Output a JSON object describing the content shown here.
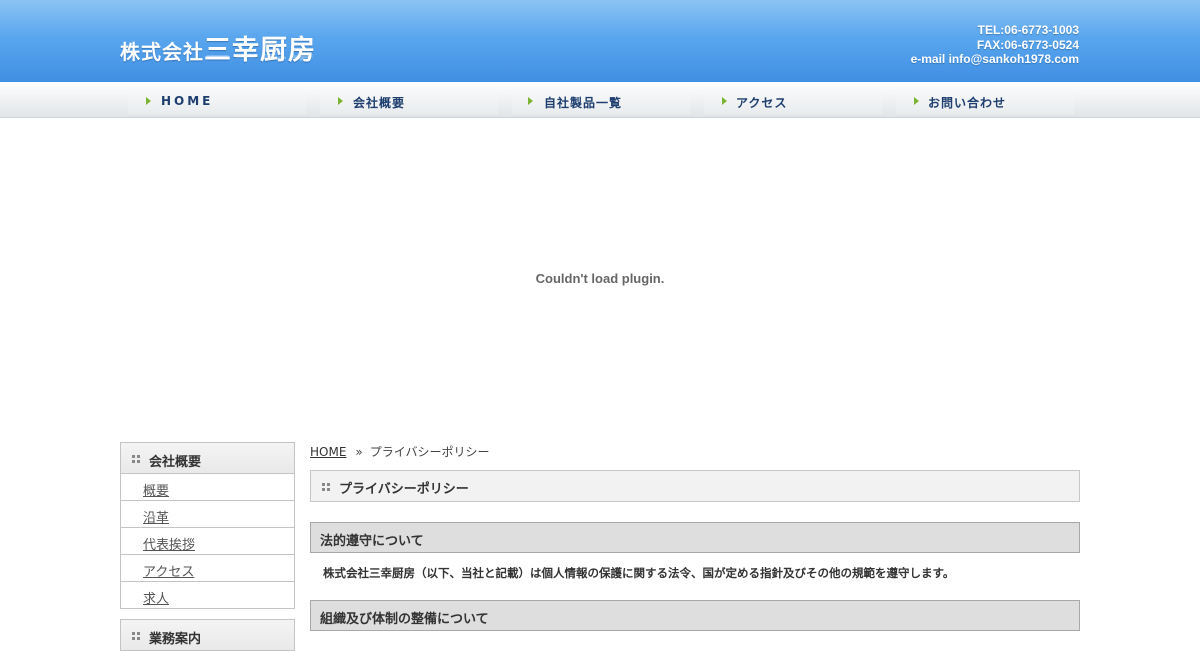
{
  "header": {
    "logo_small": "株式会社",
    "logo_big": "三幸厨房",
    "tel": "TEL:06-6773-1003",
    "fax": "FAX:06-6773-0524",
    "email": "e-mail info@sankoh1978.com",
    "colors": {
      "header_top": "#8cc4f4",
      "header_bottom": "#3f8fe3",
      "nav_text": "#1d3e6e",
      "nav_arrow": "#7ab435"
    }
  },
  "nav": {
    "items": [
      {
        "label": "HOME"
      },
      {
        "label": "会社概要"
      },
      {
        "label": "自社製品一覧"
      },
      {
        "label": "アクセス"
      },
      {
        "label": "お問い合わせ"
      }
    ]
  },
  "plugin": {
    "message": "Couldn't load plugin."
  },
  "sidebar": {
    "heading": "会社概要",
    "items": [
      {
        "label": "概要"
      },
      {
        "label": "沿革"
      },
      {
        "label": "代表挨拶"
      },
      {
        "label": "アクセス"
      },
      {
        "label": "求人"
      }
    ],
    "heading2": "業務案内"
  },
  "main": {
    "breadcrumb": {
      "home": "HOME",
      "separator": "»",
      "current": "プライバシーポリシー"
    },
    "page_title": "プライバシーポリシー",
    "sections": [
      {
        "heading": "法的遵守について",
        "text": "株式会社三幸厨房（以下、当社と記載）は個人情報の保護に関する法令、国が定める指針及びその他の規範を遵守します。"
      },
      {
        "heading": "組織及び体制の整備について"
      }
    ]
  }
}
